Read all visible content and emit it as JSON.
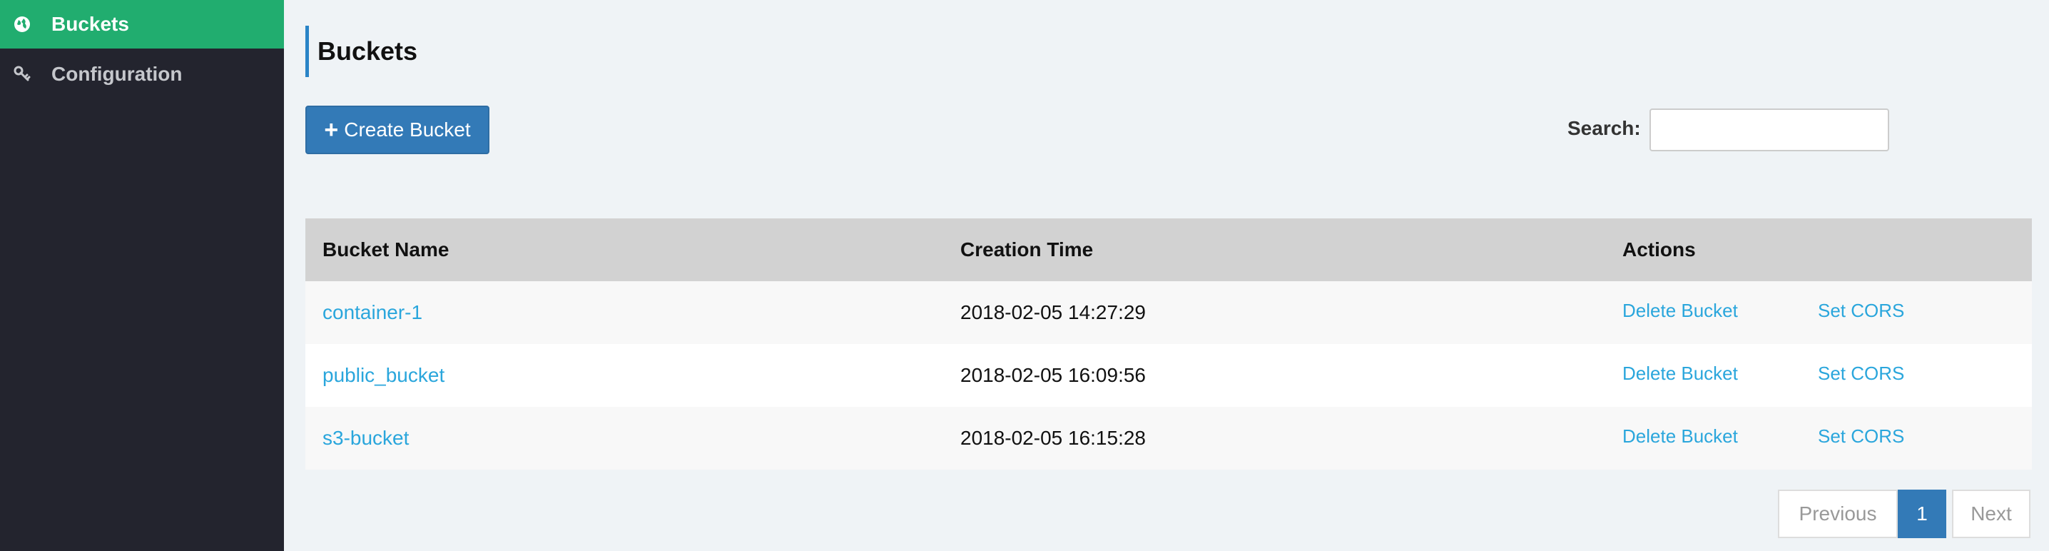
{
  "sidebar": {
    "items": [
      {
        "label": "Buckets",
        "icon": "globe-icon",
        "active": true
      },
      {
        "label": "Configuration",
        "icon": "wrench-icon",
        "active": false
      }
    ]
  },
  "header": {
    "title": "Buckets"
  },
  "toolbar": {
    "create_plus": "+",
    "create_label": "Create Bucket",
    "search_label": "Search:",
    "search_value": ""
  },
  "table": {
    "columns": [
      "Bucket Name",
      "Creation Time",
      "Actions"
    ],
    "rows": [
      {
        "name": "container-1",
        "created": "2018-02-05 14:27:29",
        "delete": "Delete Bucket",
        "cors": "Set CORS"
      },
      {
        "name": "public_bucket",
        "created": "2018-02-05 16:09:56",
        "delete": "Delete Bucket",
        "cors": "Set CORS"
      },
      {
        "name": "s3-bucket",
        "created": "2018-02-05 16:15:28",
        "delete": "Delete Bucket",
        "cors": "Set CORS"
      }
    ]
  },
  "pagination": {
    "previous": "Previous",
    "current": "1",
    "next": "Next"
  },
  "colors": {
    "sidebar_bg": "#23242e",
    "active_green": "#21ad6f",
    "primary_blue": "#337ab7",
    "link_blue": "#2aa6dc"
  }
}
